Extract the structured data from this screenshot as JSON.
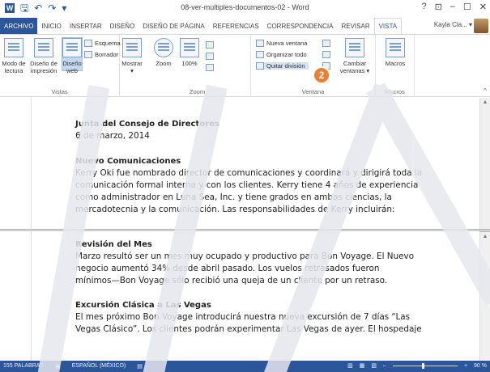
{
  "window": {
    "title": "08-ver-multiples-documentos-02 - Word",
    "help": "?",
    "minimize": "–",
    "restore": "☐",
    "close": "✕"
  },
  "qat": {
    "save": "🖫",
    "undo": "↶",
    "redo": "↷",
    "customize": "▾"
  },
  "tabs": [
    "ARCHIVO",
    "INICIO",
    "INSERTAR",
    "DISEÑO",
    "DISEÑO DE PÁGINA",
    "REFERENCIAS",
    "CORRESPONDENCIA",
    "REVISAR",
    "VISTA"
  ],
  "active_tab": "VISTA",
  "user": "Kayla Cla... ▾",
  "ribbon": {
    "vistas": {
      "label": "Vistas",
      "modo_lectura": "Modo de lectura",
      "diseno_impresion": "Diseño de impresión",
      "diseno_web": "Diseño web",
      "esquema": "Esquema",
      "borrador": "Borrador"
    },
    "mostrar": {
      "label": "Mostrar ▾"
    },
    "zoom": {
      "label": "Zoom",
      "zoom": "Zoom",
      "cien": "100%"
    },
    "ventana": {
      "label": "Ventana",
      "nueva_ventana": "Nueva ventana",
      "organizar_todo": "Organizar todo",
      "quitar_division": "Quitar división",
      "cambiar_ventanas": "Cambiar ventanas ▾"
    },
    "macros": {
      "label": "Macros",
      "macros": "Macros"
    }
  },
  "callout": "2",
  "pane_top": {
    "board_title": "Junta del Consejo de Directores",
    "date": "6 de marzo, 2014",
    "section_title": "Nuevo Comunicaciones",
    "lines": [
      "Kerry Oki fue nombrado director de comunicaciones y coordinará y dirigirá toda la",
      "comunicación formal interna y con los clientes. Kerry tiene 4 años de experiencia",
      "como administrador en Luna Sea, Inc. y tiene grados en ambas ciencias, la",
      "mercadotecnia y la comunicación. Las responsabilidades de Kerry incluirán:"
    ]
  },
  "pane_bottom": {
    "section1_title": "Revisión del Mes",
    "section1_lines": [
      "Marzo resultó ser un mes muy ocupado y productivo para Bon Voyage. El Nuevo",
      "negocio aumentó 34% desde abril pasado. Los vuelos retrasados fueron",
      "mínimos—Bon Voyage sólo recibió una queja de un cliente por un retraso."
    ],
    "section2_title": "Excursión Clásica a Las Vegas",
    "section2_lines": [
      "El mes próximo Bon Voyage introducirá nuestra nueva excursión de 7 días “Las",
      "Vegas Clásico”. Los clientes podrán experimentar Las Vegas de ayer. El hospedaje"
    ]
  },
  "status": {
    "words": "155 PALABRAS",
    "language": "ESPAÑOL (MÉXICO)",
    "zoom_out": "–",
    "zoom_in": "+",
    "zoom_level": "90 %"
  },
  "zoom_fraction": 0.45,
  "colors": {
    "accent": "#2b579a",
    "callout": "#ee7d31"
  }
}
